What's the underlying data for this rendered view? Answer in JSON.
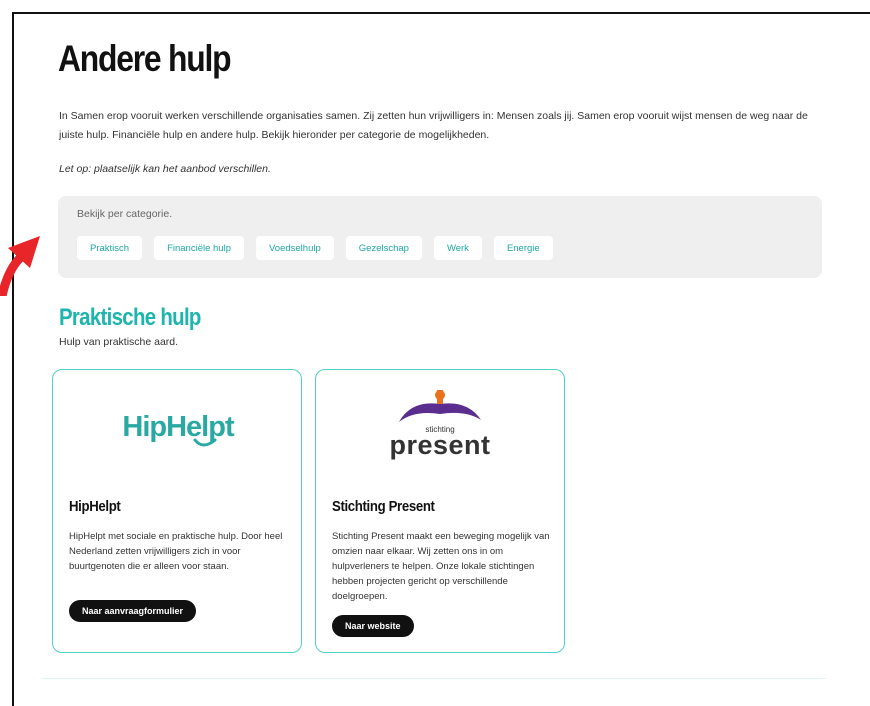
{
  "page": {
    "title": "Andere hulp",
    "intro": "In Samen erop vooruit werken verschillende organisaties samen. Zij zetten hun vrijwilligers in: Mensen zoals jij. Samen erop vooruit wijst mensen de weg naar de juiste hulp. Financiële hulp en andere hulp. Bekijk hieronder per categorie de mogelijkheden.",
    "note": "Let op: plaatselijk kan het aanbod verschillen."
  },
  "categories": {
    "label": "Bekijk per categorie.",
    "items": [
      "Praktisch",
      "Financiële hulp",
      "Voedselhulp",
      "Gezelschap",
      "Werk",
      "Energie"
    ]
  },
  "section": {
    "title": "Praktische hulp",
    "subtitle": "Hulp van praktische aard."
  },
  "cards": [
    {
      "logo_text": "HipHelpt",
      "title": "HipHelpt",
      "description": "HipHelpt met sociale en praktische hulp. Door heel Nederland zetten vrijwilligers zich in voor buurtgenoten die er alleen voor staan.",
      "button": "Naar aanvraagformulier"
    },
    {
      "logo_small": "stichting",
      "logo_text": "present",
      "title": "Stichting Present",
      "description": "Stichting Present maakt een beweging mogelijk van omzien naar elkaar. Wij zetten ons in om hulpverleners te helpen. Onze lokale stichtingen hebben projecten gericht op verschillende doelgroepen.",
      "button": "Naar website"
    }
  ],
  "colors": {
    "accent": "#1db5ad",
    "card_border": "#4fd2c8",
    "hiphelpt_red": "#d0202e",
    "hiphelpt_teal": "#2aa9a3",
    "present_purple": "#5b2d8e",
    "present_orange": "#e8731c",
    "arrow": "#e8262a"
  }
}
